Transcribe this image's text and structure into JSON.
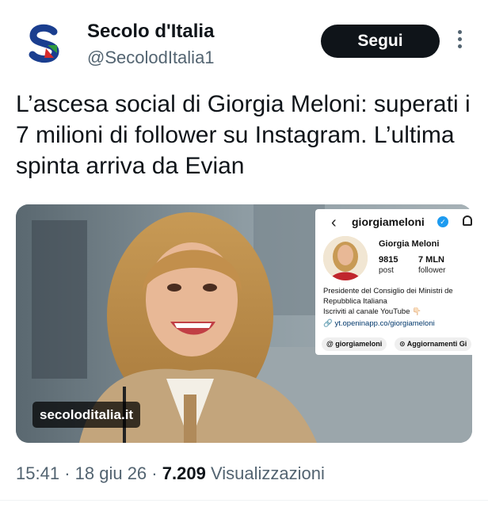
{
  "account": {
    "name": "Secolo d'Italia",
    "handle": "@SecolodItalia1",
    "avatar_letter": "S",
    "follow_label": "Segui"
  },
  "tweet": {
    "text": "L’ascesa social di Giorgia Meloni: superati i 7 milioni di follower su Instagram. L’ultima spinta arriva da Evian",
    "time": "15:41",
    "date": "18 giu 26",
    "views_count": "7.209",
    "views_label": "Visualizzazioni"
  },
  "media": {
    "site_badge": "secoloditalia.it",
    "instagram": {
      "username": "giorgiameloni",
      "full_name": "Giorgia Meloni",
      "posts_value": "9815",
      "posts_label": "post",
      "followers_value": "7 MLN",
      "followers_label": "follower",
      "bio_line1": "Presidente del Consiglio dei Ministri de",
      "bio_line2": "Repubblica Italiana",
      "bio_line3": "Iscriviti al canale YouTube 👇🏻",
      "link": "yt.openinapp.co/giorgiameloni",
      "chip1": "giorgiameloni",
      "chip2": "Aggiornamenti Gi"
    }
  },
  "colors": {
    "text_primary": "#0f1419",
    "text_secondary": "#536471",
    "button_bg": "#0f1419",
    "verified": "#1d9bf0",
    "ig_link": "#00376b"
  },
  "icons": [
    "more-vertical-icon",
    "back-chevron-icon",
    "verified-badge-icon",
    "bell-icon",
    "link-icon",
    "threads-icon",
    "channel-icon"
  ]
}
